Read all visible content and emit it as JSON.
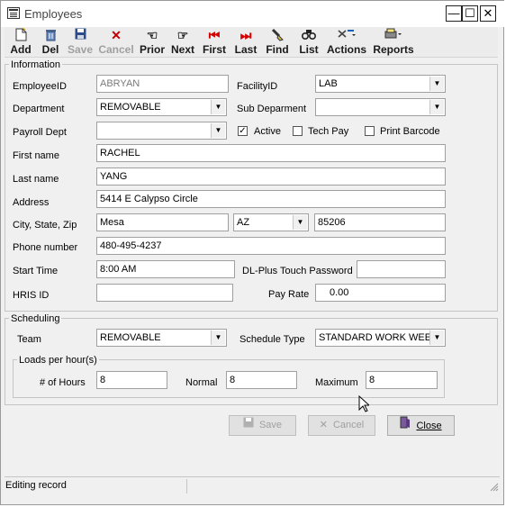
{
  "window": {
    "title": "Employees",
    "minimize": "—",
    "maximize": "☐",
    "close": "✕"
  },
  "toolbar": {
    "add": "Add",
    "del": "Del",
    "save": "Save",
    "cancel": "Cancel",
    "prior": "Prior",
    "next": "Next",
    "first": "First",
    "last": "Last",
    "find": "Find",
    "list": "List",
    "actions": "Actions",
    "reports": "Reports"
  },
  "information": {
    "legend": "Information",
    "employee_id_label": "EmployeeID",
    "employee_id": "ABRYAN",
    "facility_id_label": "FacilityID",
    "facility_id": "LAB",
    "department_label": "Department",
    "department": "REMOVABLE",
    "sub_department_label": "Sub Deparment",
    "sub_department": "",
    "payroll_dept_label": "Payroll Dept",
    "payroll_dept": "",
    "active_label": "Active",
    "active": true,
    "tech_pay_label": "Tech Pay",
    "tech_pay": false,
    "print_barcode_label": "Print Barcode",
    "print_barcode": false,
    "first_name_label": "First name",
    "first_name": "RACHEL",
    "last_name_label": "Last name",
    "last_name": "YANG",
    "address_label": "Address",
    "address": "5414 E Calypso Circle",
    "city_state_zip_label": "City, State, Zip",
    "city": "Mesa",
    "state": "AZ",
    "zip": "85206",
    "phone_label": "Phone number",
    "phone": "480-495-4237",
    "start_time_label": "Start Time",
    "start_time": "8:00 AM",
    "dl_plus_label": "DL-Plus Touch Password",
    "dl_plus": "",
    "hris_label": "HRIS ID",
    "hris": "",
    "pay_rate_label": "Pay Rate",
    "pay_rate": "0.00"
  },
  "scheduling": {
    "legend": "Scheduling",
    "team_label": "Team",
    "team": "REMOVABLE",
    "schedule_type_label": "Schedule Type",
    "schedule_type": "STANDARD WORK WEEK",
    "loads": {
      "legend": "Loads per hour(s)",
      "hours_label": "# of Hours",
      "hours": "8",
      "normal_label": "Normal",
      "normal": "8",
      "maximum_label": "Maximum",
      "maximum": "8"
    }
  },
  "buttons": {
    "save": "Save",
    "cancel": "Cancel",
    "close": "Close"
  },
  "status": {
    "text": "Editing record",
    "right": ""
  }
}
